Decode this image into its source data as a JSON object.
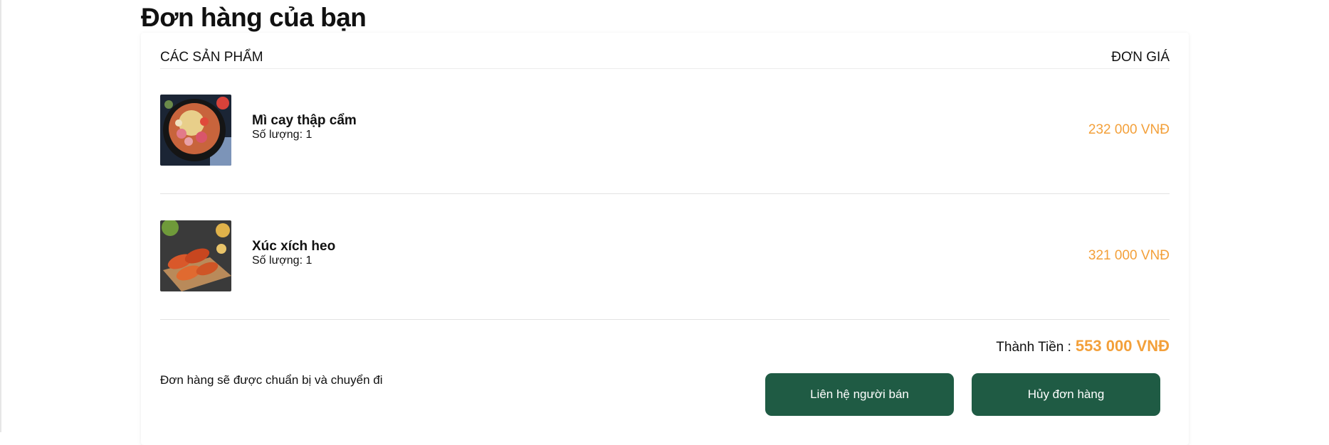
{
  "page": {
    "title": "Đơn hàng của bạn"
  },
  "table": {
    "col_products": "CÁC SẢN PHẨM",
    "col_price": "ĐƠN GIÁ"
  },
  "items": [
    {
      "name": "Mì cay thập cẩm",
      "quantity": "Số lượng: 1",
      "price": "232 000 VNĐ",
      "image": "spicy-noodle-bowl-photo"
    },
    {
      "name": "Xúc xích heo",
      "quantity": "Số lượng: 1",
      "price": "321 000 VNĐ",
      "image": "pork-sausage-platter-photo"
    }
  ],
  "summary": {
    "total_label": "Thành Tiền :",
    "total_value": "553 000 VNĐ",
    "status": "Đơn hàng sẽ được chuẩn bị và chuyển đi"
  },
  "actions": {
    "contact_label": "Liên hệ người bán",
    "cancel_label": "Hủy đơn hàng"
  },
  "colors": {
    "accent": "#f3a03a",
    "button": "#1f5b44",
    "button_text": "#ffffff"
  }
}
